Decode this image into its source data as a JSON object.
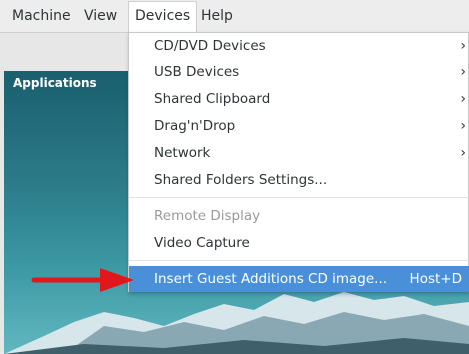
{
  "menubar": {
    "items": [
      {
        "label": "Machine"
      },
      {
        "label": "View"
      },
      {
        "label": "Devices"
      },
      {
        "label": "Help"
      }
    ]
  },
  "guest": {
    "topbar_label": "Applications"
  },
  "devices_menu": {
    "items": [
      {
        "label": "CD/DVD Devices",
        "arrow": "›"
      },
      {
        "label": "USB Devices",
        "arrow": "›"
      },
      {
        "label": "Shared Clipboard",
        "arrow": "›"
      },
      {
        "label": "Drag'n'Drop",
        "arrow": "›"
      },
      {
        "label": "Network",
        "arrow": "›"
      },
      {
        "label": "Shared Folders Settings..."
      },
      {
        "label": "Remote Display"
      },
      {
        "label": "Video Capture"
      },
      {
        "label": "Insert Guest Additions CD image...",
        "shortcut": "Host+D"
      }
    ]
  },
  "colors": {
    "highlight": "#4a90d9",
    "annotation_arrow": "#e3161b"
  }
}
